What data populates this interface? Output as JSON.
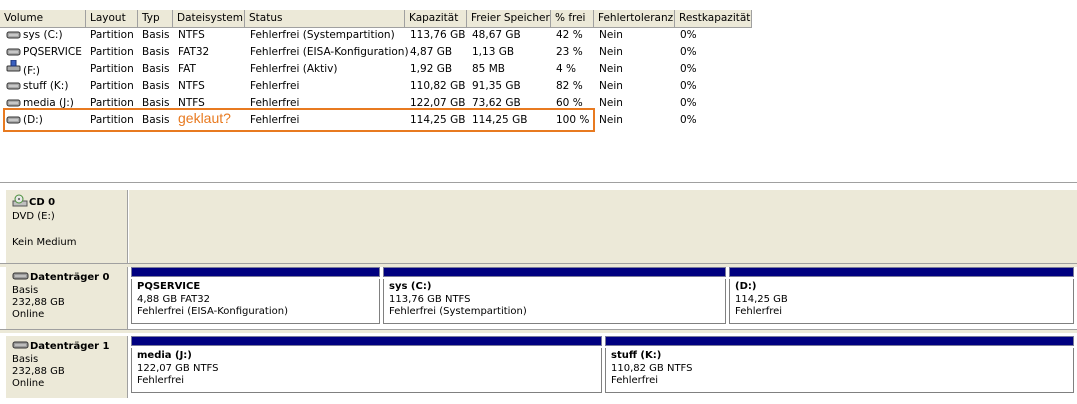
{
  "columns": [
    "Volume",
    "Layout",
    "Typ",
    "Dateisystem",
    "Status",
    "Kapazität",
    "Freier Speicher",
    "% frei",
    "Fehlertoleranz",
    "Restkapazität"
  ],
  "volumes": [
    {
      "name": "sys (C:)",
      "layout": "Partition",
      "type": "Basis",
      "fs": "NTFS",
      "status": "Fehlerfrei (Systempartition)",
      "capacity": "113,76 GB",
      "free": "48,67 GB",
      "pct": "42 %",
      "fault": "Nein",
      "overhead": "0%",
      "icon": "drive-icon"
    },
    {
      "name": "PQSERVICE",
      "layout": "Partition",
      "type": "Basis",
      "fs": "FAT32",
      "status": "Fehlerfrei (EISA-Konfiguration)",
      "capacity": "4,87 GB",
      "free": "1,13 GB",
      "pct": "23 %",
      "fault": "Nein",
      "overhead": "0%",
      "icon": "drive-icon"
    },
    {
      "name": "(F:)",
      "layout": "Partition",
      "type": "Basis",
      "fs": "FAT",
      "status": "Fehlerfrei (Aktiv)",
      "capacity": "1,92 GB",
      "free": "85 MB",
      "pct": "4 %",
      "fault": "Nein",
      "overhead": "0%",
      "icon": "removable-drive-icon"
    },
    {
      "name": "stuff (K:)",
      "layout": "Partition",
      "type": "Basis",
      "fs": "NTFS",
      "status": "Fehlerfrei",
      "capacity": "110,82 GB",
      "free": "91,35 GB",
      "pct": "82 %",
      "fault": "Nein",
      "overhead": "0%",
      "icon": "drive-icon"
    },
    {
      "name": "media (J:)",
      "layout": "Partition",
      "type": "Basis",
      "fs": "NTFS",
      "status": "Fehlerfrei",
      "capacity": "122,07 GB",
      "free": "73,62 GB",
      "pct": "60 %",
      "fault": "Nein",
      "overhead": "0%",
      "icon": "drive-icon"
    },
    {
      "name": "(D:)",
      "layout": "Partition",
      "type": "Basis",
      "fs": "",
      "status": "Fehlerfrei",
      "capacity": "114,25 GB",
      "free": "114,25 GB",
      "pct": "100 %",
      "fault": "Nein",
      "overhead": "0%",
      "icon": "drive-icon"
    }
  ],
  "annotation": "geklaut?",
  "disks": {
    "cd0": {
      "title": "CD 0",
      "line1": "DVD (E:)",
      "line2": "",
      "line3": "Kein Medium"
    },
    "disk0": {
      "title": "Datenträger 0",
      "line1": "Basis",
      "line2": "232,88 GB",
      "line3": "Online",
      "partitions": [
        {
          "name": "PQSERVICE",
          "size": "4,88 GB FAT32",
          "status": "Fehlerfrei (EISA-Konfiguration)"
        },
        {
          "name": "sys  (C:)",
          "size": "113,76 GB NTFS",
          "status": "Fehlerfrei (Systempartition)"
        },
        {
          "name": " (D:)",
          "size": "114,25 GB",
          "status": "Fehlerfrei"
        }
      ]
    },
    "disk1": {
      "title": "Datenträger 1",
      "line1": "Basis",
      "line2": "232,88 GB",
      "line3": "Online",
      "partitions": [
        {
          "name": "media  (J:)",
          "size": "122,07 GB NTFS",
          "status": "Fehlerfrei"
        },
        {
          "name": "stuff  (K:)",
          "size": "110,82 GB NTFS",
          "status": "Fehlerfrei"
        }
      ]
    }
  },
  "colors": {
    "accent": "#e87a20",
    "partition_bar": "#000080",
    "panel": "#ece9d8"
  }
}
